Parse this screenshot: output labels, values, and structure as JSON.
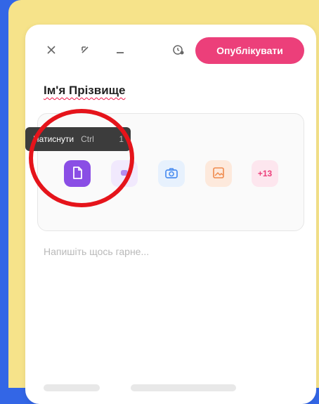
{
  "editor": {
    "author_name": "Ім'я Прізвище",
    "publish_label": "Опублікувати",
    "placeholder": "Напишіть щось гарне...",
    "tooltip": {
      "label": "Натиснути",
      "shortcut": "Ctrl",
      "key": "1"
    },
    "attach_tiles": [
      {
        "name": "file",
        "label": ""
      },
      {
        "name": "gif",
        "label": ""
      },
      {
        "name": "camera",
        "label": ""
      },
      {
        "name": "image",
        "label": ""
      },
      {
        "name": "more",
        "label": "+13"
      }
    ]
  },
  "colors": {
    "background_blue": "#3366e6",
    "frame_yellow": "#f6e38a",
    "publish_pink": "#ec3f7a",
    "file_purple": "#8a4ee5",
    "annotation_red": "#e5141b"
  },
  "icons": {
    "close": "close-icon",
    "collapse": "collapse-icon",
    "minimize": "minimize-icon",
    "timer": "timer-icon",
    "file": "file-icon",
    "gif": "gif-icon",
    "camera": "camera-icon",
    "image": "image-icon"
  }
}
